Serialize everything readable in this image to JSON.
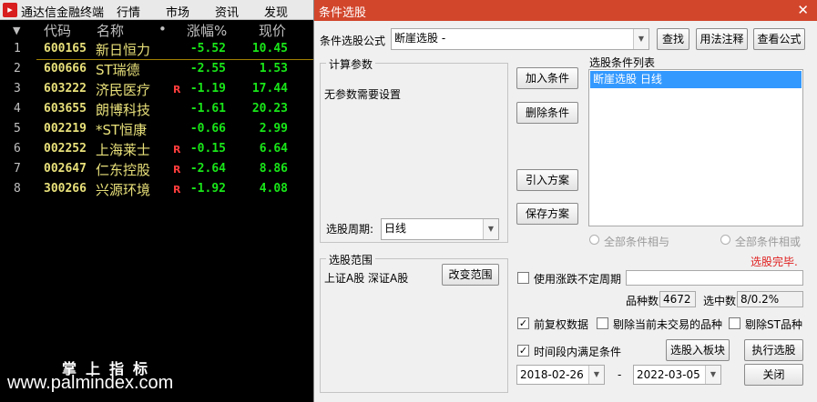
{
  "app": {
    "logo_text": "▸",
    "title": "通达信金融终端",
    "menus": [
      "行情",
      "市场",
      "资讯",
      "发现"
    ]
  },
  "table": {
    "headers": {
      "sort": "▼",
      "code": "代码",
      "name": "名称",
      "dot": "•",
      "change": "涨幅%",
      "price": "现价"
    },
    "rows": [
      {
        "idx": "1",
        "code": "600165",
        "name": "新日恒力",
        "flag": "",
        "change": "-5.52",
        "price": "10.45"
      },
      {
        "idx": "2",
        "code": "600666",
        "name": "ST瑞德",
        "flag": "",
        "change": "-2.55",
        "price": "1.53"
      },
      {
        "idx": "3",
        "code": "603222",
        "name": "济民医疗",
        "flag": "R",
        "change": "-1.19",
        "price": "17.44"
      },
      {
        "idx": "4",
        "code": "603655",
        "name": "朗博科技",
        "flag": "",
        "change": "-1.61",
        "price": "20.23"
      },
      {
        "idx": "5",
        "code": "002219",
        "name": "*ST恒康",
        "flag": "",
        "change": "-0.66",
        "price": "2.99"
      },
      {
        "idx": "6",
        "code": "002252",
        "name": "上海莱士",
        "flag": "R",
        "change": "-0.15",
        "price": "6.64"
      },
      {
        "idx": "7",
        "code": "002647",
        "name": "仁东控股",
        "flag": "R",
        "change": "-2.64",
        "price": "8.86"
      },
      {
        "idx": "8",
        "code": "300266",
        "name": "兴源环境",
        "flag": "R",
        "change": "-1.92",
        "price": "4.08"
      }
    ],
    "colors": {
      "code": "#e8e07a",
      "change": "#19e619",
      "flag": "#ff3d3d"
    }
  },
  "watermark": {
    "cn": "掌上指标",
    "url": "www.palmindex.com"
  },
  "dialog": {
    "title": "条件选股",
    "close": "✕",
    "formula_label": "条件选股公式",
    "formula_value": "断崖选股    -",
    "buttons": {
      "find": "查找",
      "usage": "用法注释",
      "view": "查看公式",
      "add": "加入条件",
      "delete": "删除条件",
      "import": "引入方案",
      "save": "保存方案",
      "change_range": "改变范围",
      "to_block": "选股入板块",
      "run": "执行选股",
      "close": "关闭"
    },
    "params": {
      "title": "计算参数",
      "text": "无参数需要设置",
      "period_label": "选股周期:",
      "period_value": "日线"
    },
    "cond_list": {
      "title": "选股条件列表",
      "items": [
        "断崖选股  日线"
      ]
    },
    "radios": {
      "and": "全部条件相与",
      "or": "全部条件相或"
    },
    "status": "选股完毕.",
    "range": {
      "title": "选股范围",
      "text": "上证A股 深证A股"
    },
    "use_period": {
      "label": "使用涨跌不定周期",
      "checked": false
    },
    "counts": {
      "total_label": "品种数",
      "total": "4672",
      "selected_label": "选中数",
      "selected": "8/0.2%"
    },
    "options": [
      {
        "label": "前复权数据",
        "checked": true
      },
      {
        "label": "剔除当前未交易的品种",
        "checked": false
      },
      {
        "label": "剔除ST品种",
        "checked": false
      }
    ],
    "time_range": {
      "label": "时间段内满足条件",
      "checked": true,
      "start": "2018-02-26",
      "dash": "-",
      "end": "2022-03-05"
    }
  }
}
